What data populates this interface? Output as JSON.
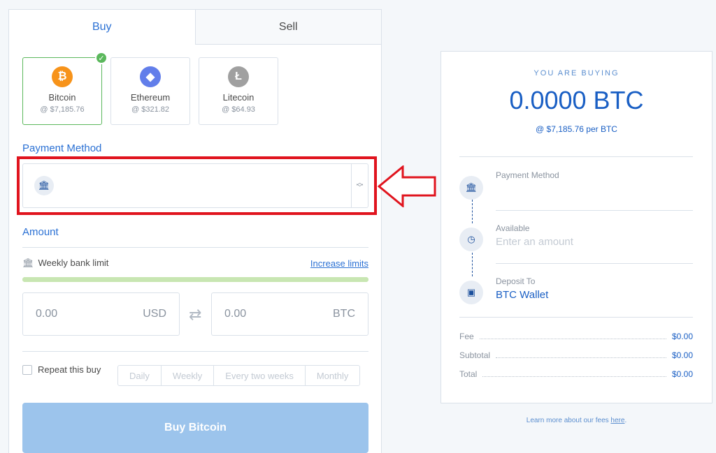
{
  "tabs": {
    "buy": "Buy",
    "sell": "Sell"
  },
  "coins": [
    {
      "name": "Bitcoin",
      "price": "@ $7,185.76",
      "symbol": "₿",
      "color": "#f7931a",
      "selected": true
    },
    {
      "name": "Ethereum",
      "price": "@ $321.82",
      "symbol": "◆",
      "color": "#627eea",
      "selected": false
    },
    {
      "name": "Litecoin",
      "price": "@ $64.93",
      "symbol": "Ł",
      "color": "#a0a0a0",
      "selected": false
    }
  ],
  "payment_method": {
    "label": "Payment Method",
    "icon": "bank-icon"
  },
  "amount": {
    "label": "Amount",
    "limit_label": "Weekly bank limit",
    "increase_link": "Increase limits",
    "limit_fill_fraction": 1.0,
    "usd_value": "0.00",
    "usd_unit": "USD",
    "btc_value": "0.00",
    "btc_unit": "BTC",
    "swap_icon": "⇄"
  },
  "repeat": {
    "label": "Repeat this buy",
    "options": [
      "Daily",
      "Weekly",
      "Every two weeks",
      "Monthly"
    ]
  },
  "buy_button": "Buy Bitcoin",
  "summary": {
    "heading": "YOU ARE BUYING",
    "amount": "0.0000 BTC",
    "rate": "@ $7,185.76 per BTC",
    "payment_method_label": "Payment Method",
    "available_label": "Available",
    "available_value": "Enter an amount",
    "deposit_label": "Deposit To",
    "deposit_value": "BTC Wallet",
    "fee_label": "Fee",
    "fee_value": "$0.00",
    "subtotal_label": "Subtotal",
    "subtotal_value": "$0.00",
    "total_label": "Total",
    "total_value": "$0.00"
  },
  "learn_more": {
    "text": "Learn more about our fees ",
    "link": "here"
  },
  "colors": {
    "accent": "#2b71d4",
    "success": "#5bb85c",
    "highlight": "#e0141e",
    "button": "#9cc4ec"
  }
}
